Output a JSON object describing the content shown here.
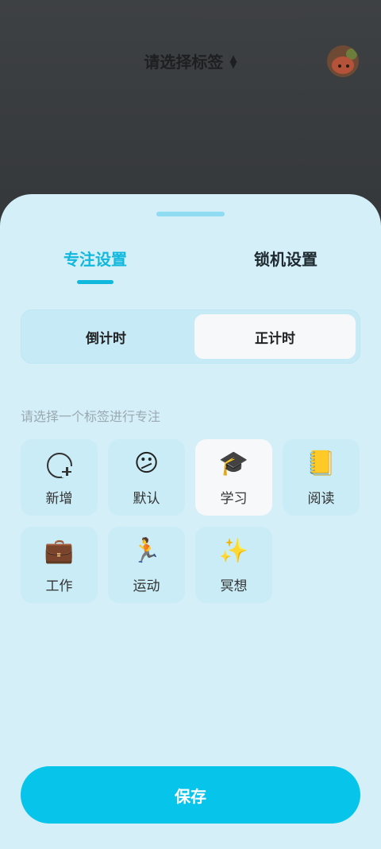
{
  "background": {
    "title": "请选择标签",
    "updown_icon": "sort-updown-icon",
    "avatar": "avatar-bear"
  },
  "sheet": {
    "tabs": [
      {
        "label": "专注设置",
        "active": true
      },
      {
        "label": "锁机设置",
        "active": false
      }
    ],
    "segment": {
      "options": [
        "倒计时",
        "正计时"
      ],
      "selected": "正计时"
    },
    "hint": "请选择一个标签进行专注",
    "tags": [
      {
        "label": "新增",
        "icon": "add-circle-icon",
        "glyph": ""
      },
      {
        "label": "默认",
        "icon": "confused-face-icon",
        "glyph": "😕"
      },
      {
        "label": "学习",
        "icon": "graduation-cap-icon",
        "glyph": "🎓",
        "selected": true
      },
      {
        "label": "阅读",
        "icon": "notebook-icon",
        "glyph": "📒"
      },
      {
        "label": "工作",
        "icon": "briefcase-icon",
        "glyph": "💼"
      },
      {
        "label": "运动",
        "icon": "running-icon",
        "glyph": "🏃"
      },
      {
        "label": "冥想",
        "icon": "sparkles-icon",
        "glyph": "✨"
      }
    ],
    "save_label": "保存"
  },
  "colors": {
    "accent": "#10b8de",
    "sheet_bg": "#d4eff8",
    "save_button": "#06c4ea"
  }
}
